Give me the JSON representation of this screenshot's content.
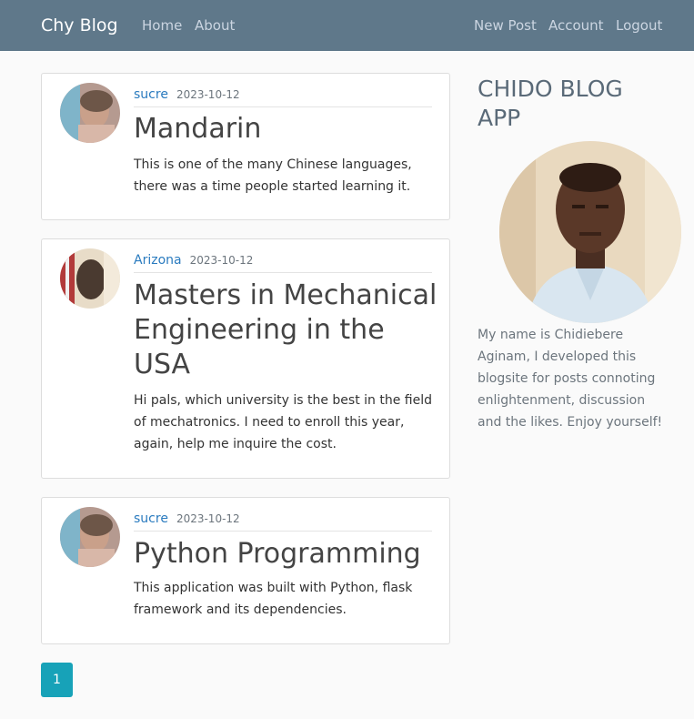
{
  "navbar": {
    "brand": "Chy Blog",
    "left_links": [
      "Home",
      "About"
    ],
    "right_links": [
      "New Post",
      "Account",
      "Logout"
    ]
  },
  "posts": [
    {
      "author": "sucre",
      "date": "2023-10-12",
      "title": "Mandarin",
      "body": "This is one of the many Chinese languages, there was a time people started learning it."
    },
    {
      "author": "Arizona",
      "date": "2023-10-12",
      "title": "Masters in Mechanical Engineering in the USA",
      "body": "Hi pals, which university is the best in the field of mechatronics. I need to enroll this year, again, help me inquire the cost."
    },
    {
      "author": "sucre",
      "date": "2023-10-12",
      "title": "Python Programming",
      "body": "This application was built with Python, flask framework and its dependencies."
    }
  ],
  "pagination": {
    "current_page": "1"
  },
  "sidebar": {
    "title": "CHIDO BLOG APP",
    "bio": "My name is Chidiebere Aginam, I developed this blogsite for posts connoting enlightenment, discussion and the likes. Enjoy yourself!"
  },
  "colors": {
    "navbar": "#5f788a",
    "link": "#2a7bbf",
    "pagination_active": "#17a2b8"
  }
}
